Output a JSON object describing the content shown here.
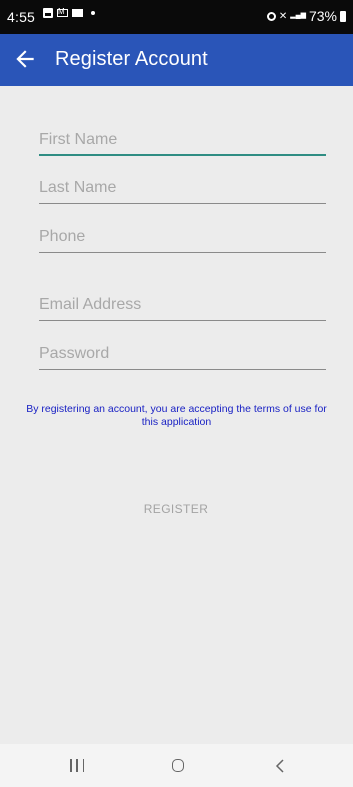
{
  "status_bar": {
    "time": "4:55",
    "battery": "73%",
    "left_icons": [
      "image-icon",
      "gmail-icon",
      "message-icon",
      "dot-icon"
    ],
    "right_icons": [
      "alarm-icon",
      "mute-icon",
      "signal-icon",
      "battery-icon"
    ]
  },
  "app_bar": {
    "title": "Register Account",
    "back_icon": "arrow-left-icon",
    "color": "#2a55b8"
  },
  "form": {
    "first_name": {
      "placeholder": "First Name",
      "value": ""
    },
    "last_name": {
      "placeholder": "Last Name",
      "value": ""
    },
    "phone": {
      "placeholder": "Phone",
      "value": ""
    },
    "email": {
      "placeholder": "Email Address",
      "value": ""
    },
    "password": {
      "placeholder": "Password",
      "value": ""
    },
    "active_underline_color": "#2f8d83"
  },
  "terms_text": "By registering an account, you are accepting the terms of use for this application",
  "register_label": "REGISTER",
  "nav_bar": {
    "icons": [
      "recents-icon",
      "home-icon",
      "back-icon"
    ]
  }
}
